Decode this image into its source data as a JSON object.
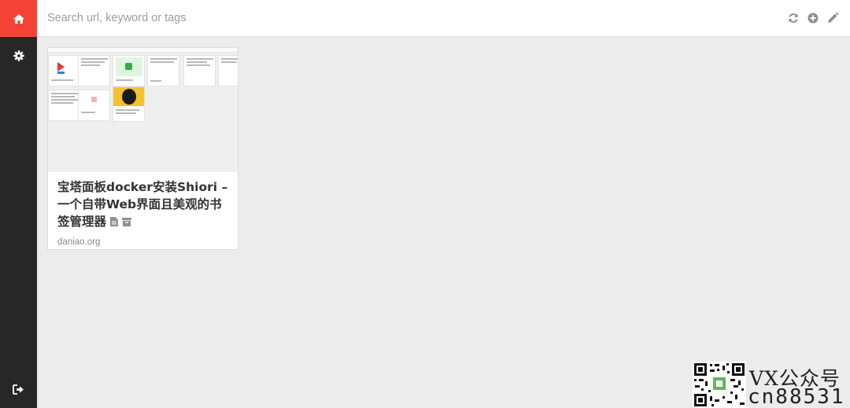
{
  "sidebar": {
    "items": [
      {
        "name": "home",
        "icon": "home-icon",
        "active": true
      },
      {
        "name": "settings",
        "icon": "gear-icon",
        "active": false
      }
    ],
    "logout_icon": "logout-icon",
    "colors": {
      "background": "#272727",
      "active": "#f44336"
    }
  },
  "header": {
    "search": {
      "placeholder": "Search url, keyword or tags",
      "value": ""
    },
    "actions": [
      "refresh-icon",
      "add-icon",
      "edit-icon"
    ]
  },
  "bookmarks": [
    {
      "title": "宝塔面板docker安装Shiori – 一个自带Web界面且美观的书签管理器",
      "host": "daniao.org",
      "badges": [
        "document-icon",
        "archive-icon"
      ]
    }
  ],
  "watermark": {
    "line1": "VX公众号",
    "line2": "cn88531"
  }
}
